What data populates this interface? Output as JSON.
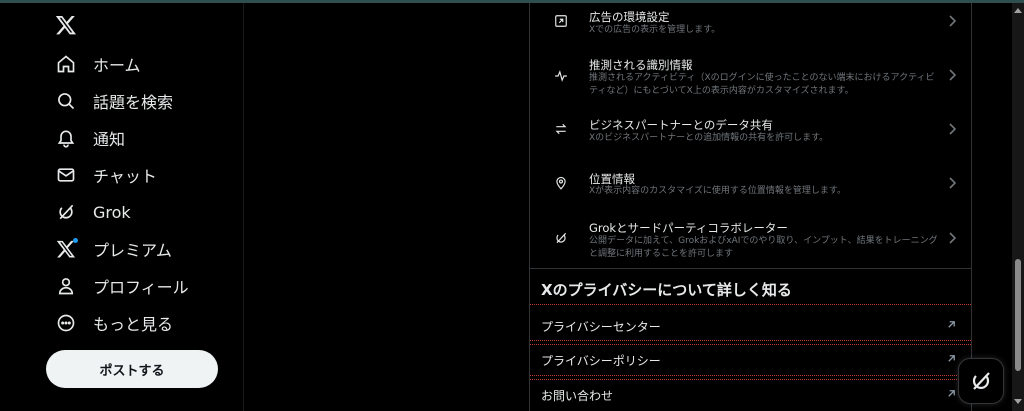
{
  "nav": {
    "items": [
      {
        "label": "ホーム",
        "icon": "home-icon"
      },
      {
        "label": "話題を検索",
        "icon": "search-icon"
      },
      {
        "label": "通知",
        "icon": "bell-icon"
      },
      {
        "label": "チャット",
        "icon": "mail-icon"
      },
      {
        "label": "Grok",
        "icon": "grok-icon"
      },
      {
        "label": "プレミアム",
        "icon": "x-premium-icon"
      },
      {
        "label": "プロフィール",
        "icon": "person-icon"
      },
      {
        "label": "もっと見る",
        "icon": "more-icon"
      }
    ],
    "post_label": "ポストする"
  },
  "settings": [
    {
      "title": "広告の環境設定",
      "desc": "Xでの広告の表示を管理します。",
      "icon": "ad-icon"
    },
    {
      "title": "推測される識別情報",
      "desc": "推測されるアクティビティ（Xのログインに使ったことのない端末におけるアクティビティなど）にもとづいてX上の表示内容がカスタマイズされます。",
      "icon": "activity-icon"
    },
    {
      "title": "ビジネスパートナーとのデータ共有",
      "desc": "Xのビジネスパートナーとの追加情報の共有を許可します。",
      "icon": "swap-icon"
    },
    {
      "title": "位置情報",
      "desc": "Xが表示内容のカスタマイズに使用する位置情報を管理します。",
      "icon": "location-icon"
    },
    {
      "title": "Grokとサードパーティコラボレーター",
      "desc": "公開データに加えて、GrokおよびxAIでのやり取り、インプット、結果をトレーニングと調整に利用することを許可します",
      "icon": "grok-icon"
    }
  ],
  "privacy": {
    "section_title": "Xのプライバシーについて詳しく知る",
    "links": [
      {
        "label": "プライバシーセンター"
      },
      {
        "label": "プライバシーポリシー"
      },
      {
        "label": "お問い合わせ"
      }
    ]
  },
  "colors": {
    "background": "#000000",
    "text": "#e7e9ea",
    "secondary_text": "#71767b",
    "post_button": "#eff3f4",
    "divider": "#2f3336",
    "premium_dot": "#1d9bf0"
  }
}
